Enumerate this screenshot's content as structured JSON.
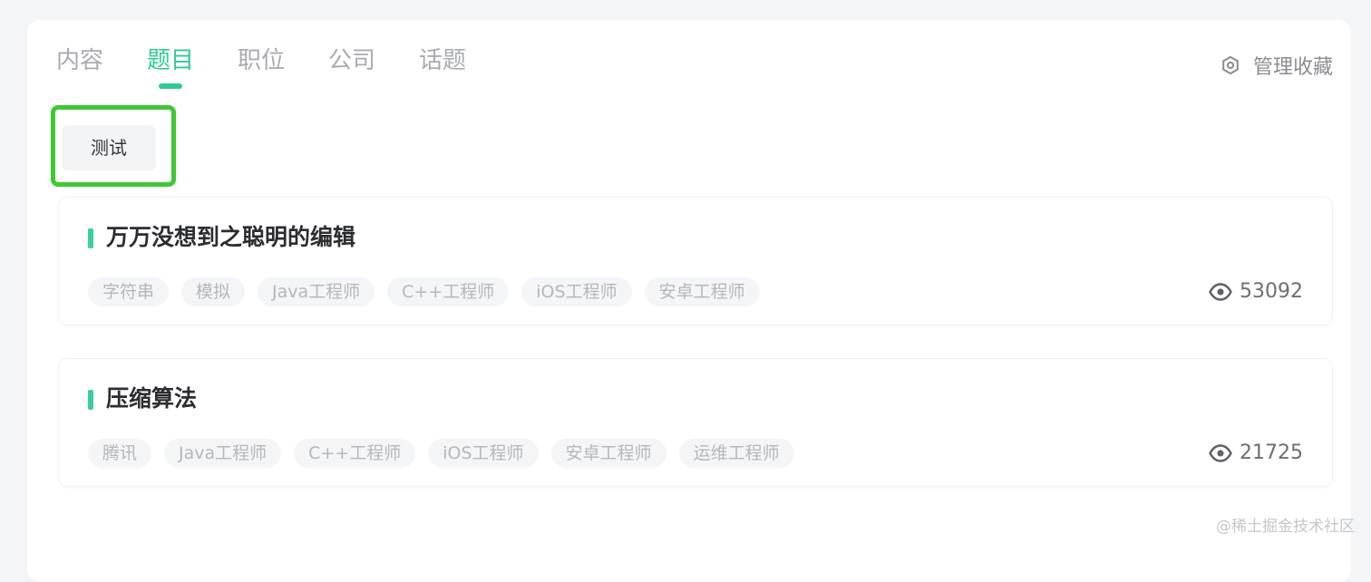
{
  "tabs": [
    "内容",
    "题目",
    "职位",
    "公司",
    "话题"
  ],
  "active_tab": "题目",
  "manage_label": "管理收藏",
  "folder_label": "测试",
  "questions": [
    {
      "title": "万万没想到之聪明的编辑",
      "tags": [
        "字符串",
        "模拟",
        "Java工程师",
        "C++工程师",
        "iOS工程师",
        "安卓工程师"
      ],
      "views": "53092"
    },
    {
      "title": "压缩算法",
      "tags": [
        "腾讯",
        "Java工程师",
        "C++工程师",
        "iOS工程师",
        "安卓工程师",
        "运维工程师"
      ],
      "views": "21725"
    }
  ],
  "watermark": "@稀土掘金技术社区",
  "colors": {
    "accent": "#2fcb94",
    "highlight_box": "#3ec934"
  },
  "icons": {
    "manage": "gear-icon",
    "views": "eye-icon"
  }
}
